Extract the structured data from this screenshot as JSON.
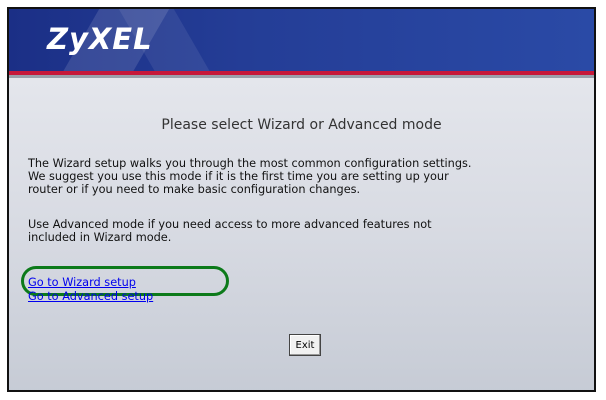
{
  "header": {
    "logo": "ZyXEL"
  },
  "main": {
    "title": "Please select Wizard or Advanced mode",
    "paragraph1_lines": [
      "The Wizard setup walks you through the most common configuration settings.",
      "We suggest you use this mode if it is the first time you are setting up your",
      "router or if you need to make basic configuration changes."
    ],
    "paragraph2_lines": [
      "Use Advanced mode if you need access to more advanced features not",
      "included in Wizard mode."
    ],
    "wizard_link": "Go to Wizard setup",
    "advanced_link": "Go to Advanced setup",
    "exit_label": "Exit"
  },
  "colors": {
    "header_blue": "#1b2f86",
    "accent_red": "#c6183a",
    "highlight_green": "#0c7a1a",
    "link_blue": "#0000ee"
  }
}
